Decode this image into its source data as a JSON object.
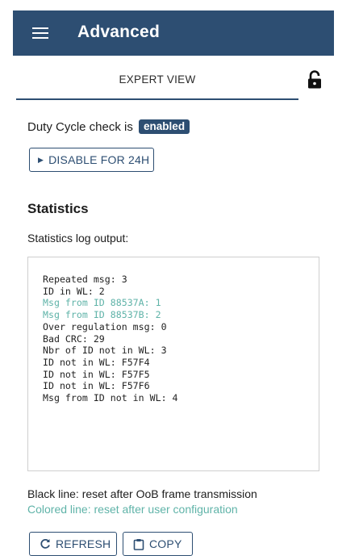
{
  "header": {
    "title": "Advanced",
    "menu_icon": "hamburger-menu-icon"
  },
  "tabs": {
    "active_label": "EXPERT VIEW",
    "lock_icon": "lock-open-icon"
  },
  "duty_cycle": {
    "text": "Duty Cycle check is",
    "status": "enabled",
    "disable_button_label": "DISABLE FOR 24H"
  },
  "statistics": {
    "title": "Statistics",
    "log_label": "Statistics log output:",
    "lines": [
      {
        "text": "Repeated msg: 3",
        "colored": false
      },
      {
        "text": "ID in WL: 2",
        "colored": false
      },
      {
        "text": "Msg from ID 88537A: 1",
        "colored": true
      },
      {
        "text": "Msg from ID 88537B: 2",
        "colored": true
      },
      {
        "text": "Over regulation msg: 0",
        "colored": false
      },
      {
        "text": "Bad CRC: 29",
        "colored": false
      },
      {
        "text": "Nbr of ID not in WL: 3",
        "colored": false
      },
      {
        "text": "ID not in WL: F57F4",
        "colored": false
      },
      {
        "text": "ID not in WL: F57F5",
        "colored": false
      },
      {
        "text": "ID not in WL: F57F6",
        "colored": false
      },
      {
        "text": "Msg from ID not in WL: 4",
        "colored": false
      }
    ],
    "legend_black": "Black line: reset after OoB frame transmission",
    "legend_colored": "Colored line: reset after user configuration"
  },
  "actions": {
    "refresh_label": "REFRESH",
    "copy_label": "COPY"
  },
  "colors": {
    "primary": "#2d4e72",
    "accent_teal": "#5fb3a8"
  }
}
